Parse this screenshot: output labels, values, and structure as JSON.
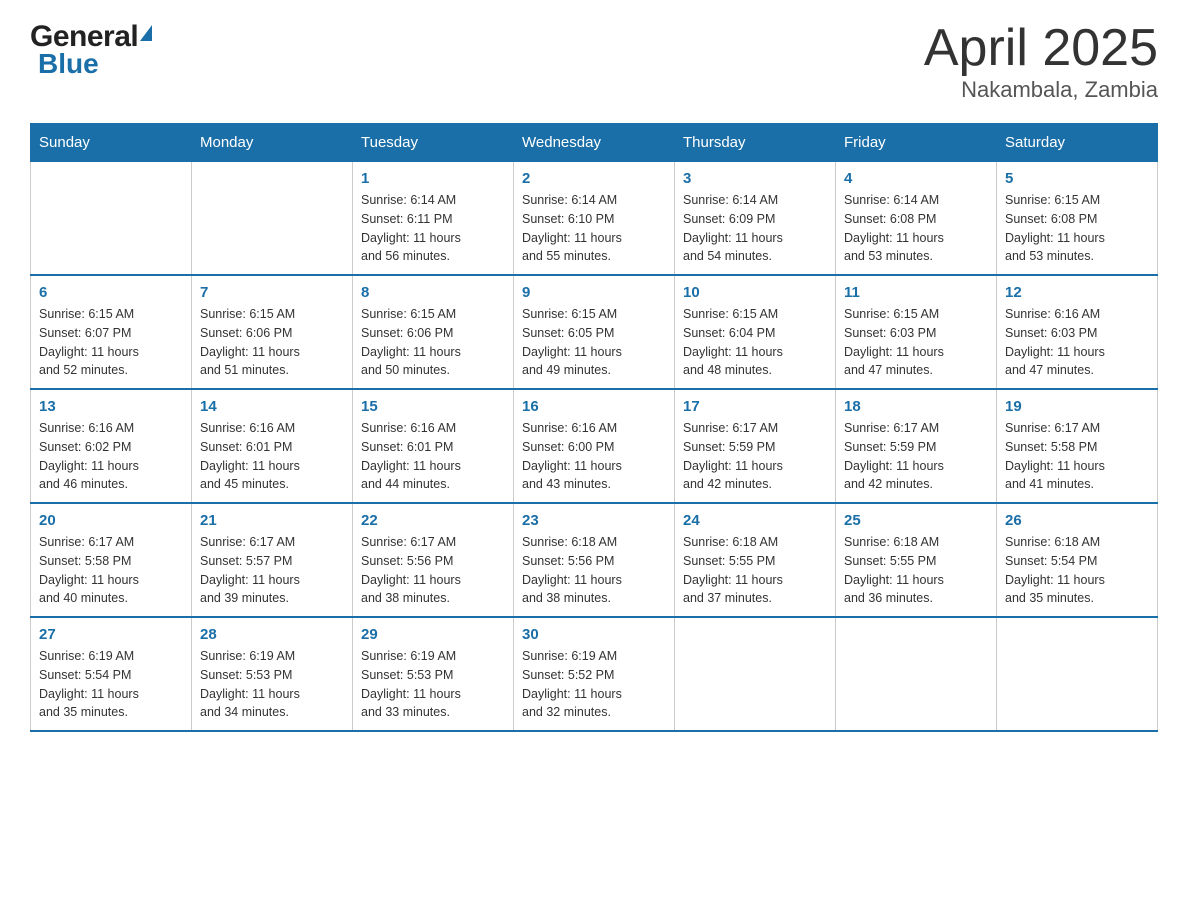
{
  "header": {
    "logo_general": "General",
    "logo_blue": "Blue",
    "month_title": "April 2025",
    "location": "Nakambala, Zambia"
  },
  "days_of_week": [
    "Sunday",
    "Monday",
    "Tuesday",
    "Wednesday",
    "Thursday",
    "Friday",
    "Saturday"
  ],
  "weeks": [
    [
      {
        "day": "",
        "info": ""
      },
      {
        "day": "",
        "info": ""
      },
      {
        "day": "1",
        "info": "Sunrise: 6:14 AM\nSunset: 6:11 PM\nDaylight: 11 hours\nand 56 minutes."
      },
      {
        "day": "2",
        "info": "Sunrise: 6:14 AM\nSunset: 6:10 PM\nDaylight: 11 hours\nand 55 minutes."
      },
      {
        "day": "3",
        "info": "Sunrise: 6:14 AM\nSunset: 6:09 PM\nDaylight: 11 hours\nand 54 minutes."
      },
      {
        "day": "4",
        "info": "Sunrise: 6:14 AM\nSunset: 6:08 PM\nDaylight: 11 hours\nand 53 minutes."
      },
      {
        "day": "5",
        "info": "Sunrise: 6:15 AM\nSunset: 6:08 PM\nDaylight: 11 hours\nand 53 minutes."
      }
    ],
    [
      {
        "day": "6",
        "info": "Sunrise: 6:15 AM\nSunset: 6:07 PM\nDaylight: 11 hours\nand 52 minutes."
      },
      {
        "day": "7",
        "info": "Sunrise: 6:15 AM\nSunset: 6:06 PM\nDaylight: 11 hours\nand 51 minutes."
      },
      {
        "day": "8",
        "info": "Sunrise: 6:15 AM\nSunset: 6:06 PM\nDaylight: 11 hours\nand 50 minutes."
      },
      {
        "day": "9",
        "info": "Sunrise: 6:15 AM\nSunset: 6:05 PM\nDaylight: 11 hours\nand 49 minutes."
      },
      {
        "day": "10",
        "info": "Sunrise: 6:15 AM\nSunset: 6:04 PM\nDaylight: 11 hours\nand 48 minutes."
      },
      {
        "day": "11",
        "info": "Sunrise: 6:15 AM\nSunset: 6:03 PM\nDaylight: 11 hours\nand 47 minutes."
      },
      {
        "day": "12",
        "info": "Sunrise: 6:16 AM\nSunset: 6:03 PM\nDaylight: 11 hours\nand 47 minutes."
      }
    ],
    [
      {
        "day": "13",
        "info": "Sunrise: 6:16 AM\nSunset: 6:02 PM\nDaylight: 11 hours\nand 46 minutes."
      },
      {
        "day": "14",
        "info": "Sunrise: 6:16 AM\nSunset: 6:01 PM\nDaylight: 11 hours\nand 45 minutes."
      },
      {
        "day": "15",
        "info": "Sunrise: 6:16 AM\nSunset: 6:01 PM\nDaylight: 11 hours\nand 44 minutes."
      },
      {
        "day": "16",
        "info": "Sunrise: 6:16 AM\nSunset: 6:00 PM\nDaylight: 11 hours\nand 43 minutes."
      },
      {
        "day": "17",
        "info": "Sunrise: 6:17 AM\nSunset: 5:59 PM\nDaylight: 11 hours\nand 42 minutes."
      },
      {
        "day": "18",
        "info": "Sunrise: 6:17 AM\nSunset: 5:59 PM\nDaylight: 11 hours\nand 42 minutes."
      },
      {
        "day": "19",
        "info": "Sunrise: 6:17 AM\nSunset: 5:58 PM\nDaylight: 11 hours\nand 41 minutes."
      }
    ],
    [
      {
        "day": "20",
        "info": "Sunrise: 6:17 AM\nSunset: 5:58 PM\nDaylight: 11 hours\nand 40 minutes."
      },
      {
        "day": "21",
        "info": "Sunrise: 6:17 AM\nSunset: 5:57 PM\nDaylight: 11 hours\nand 39 minutes."
      },
      {
        "day": "22",
        "info": "Sunrise: 6:17 AM\nSunset: 5:56 PM\nDaylight: 11 hours\nand 38 minutes."
      },
      {
        "day": "23",
        "info": "Sunrise: 6:18 AM\nSunset: 5:56 PM\nDaylight: 11 hours\nand 38 minutes."
      },
      {
        "day": "24",
        "info": "Sunrise: 6:18 AM\nSunset: 5:55 PM\nDaylight: 11 hours\nand 37 minutes."
      },
      {
        "day": "25",
        "info": "Sunrise: 6:18 AM\nSunset: 5:55 PM\nDaylight: 11 hours\nand 36 minutes."
      },
      {
        "day": "26",
        "info": "Sunrise: 6:18 AM\nSunset: 5:54 PM\nDaylight: 11 hours\nand 35 minutes."
      }
    ],
    [
      {
        "day": "27",
        "info": "Sunrise: 6:19 AM\nSunset: 5:54 PM\nDaylight: 11 hours\nand 35 minutes."
      },
      {
        "day": "28",
        "info": "Sunrise: 6:19 AM\nSunset: 5:53 PM\nDaylight: 11 hours\nand 34 minutes."
      },
      {
        "day": "29",
        "info": "Sunrise: 6:19 AM\nSunset: 5:53 PM\nDaylight: 11 hours\nand 33 minutes."
      },
      {
        "day": "30",
        "info": "Sunrise: 6:19 AM\nSunset: 5:52 PM\nDaylight: 11 hours\nand 32 minutes."
      },
      {
        "day": "",
        "info": ""
      },
      {
        "day": "",
        "info": ""
      },
      {
        "day": "",
        "info": ""
      }
    ]
  ]
}
